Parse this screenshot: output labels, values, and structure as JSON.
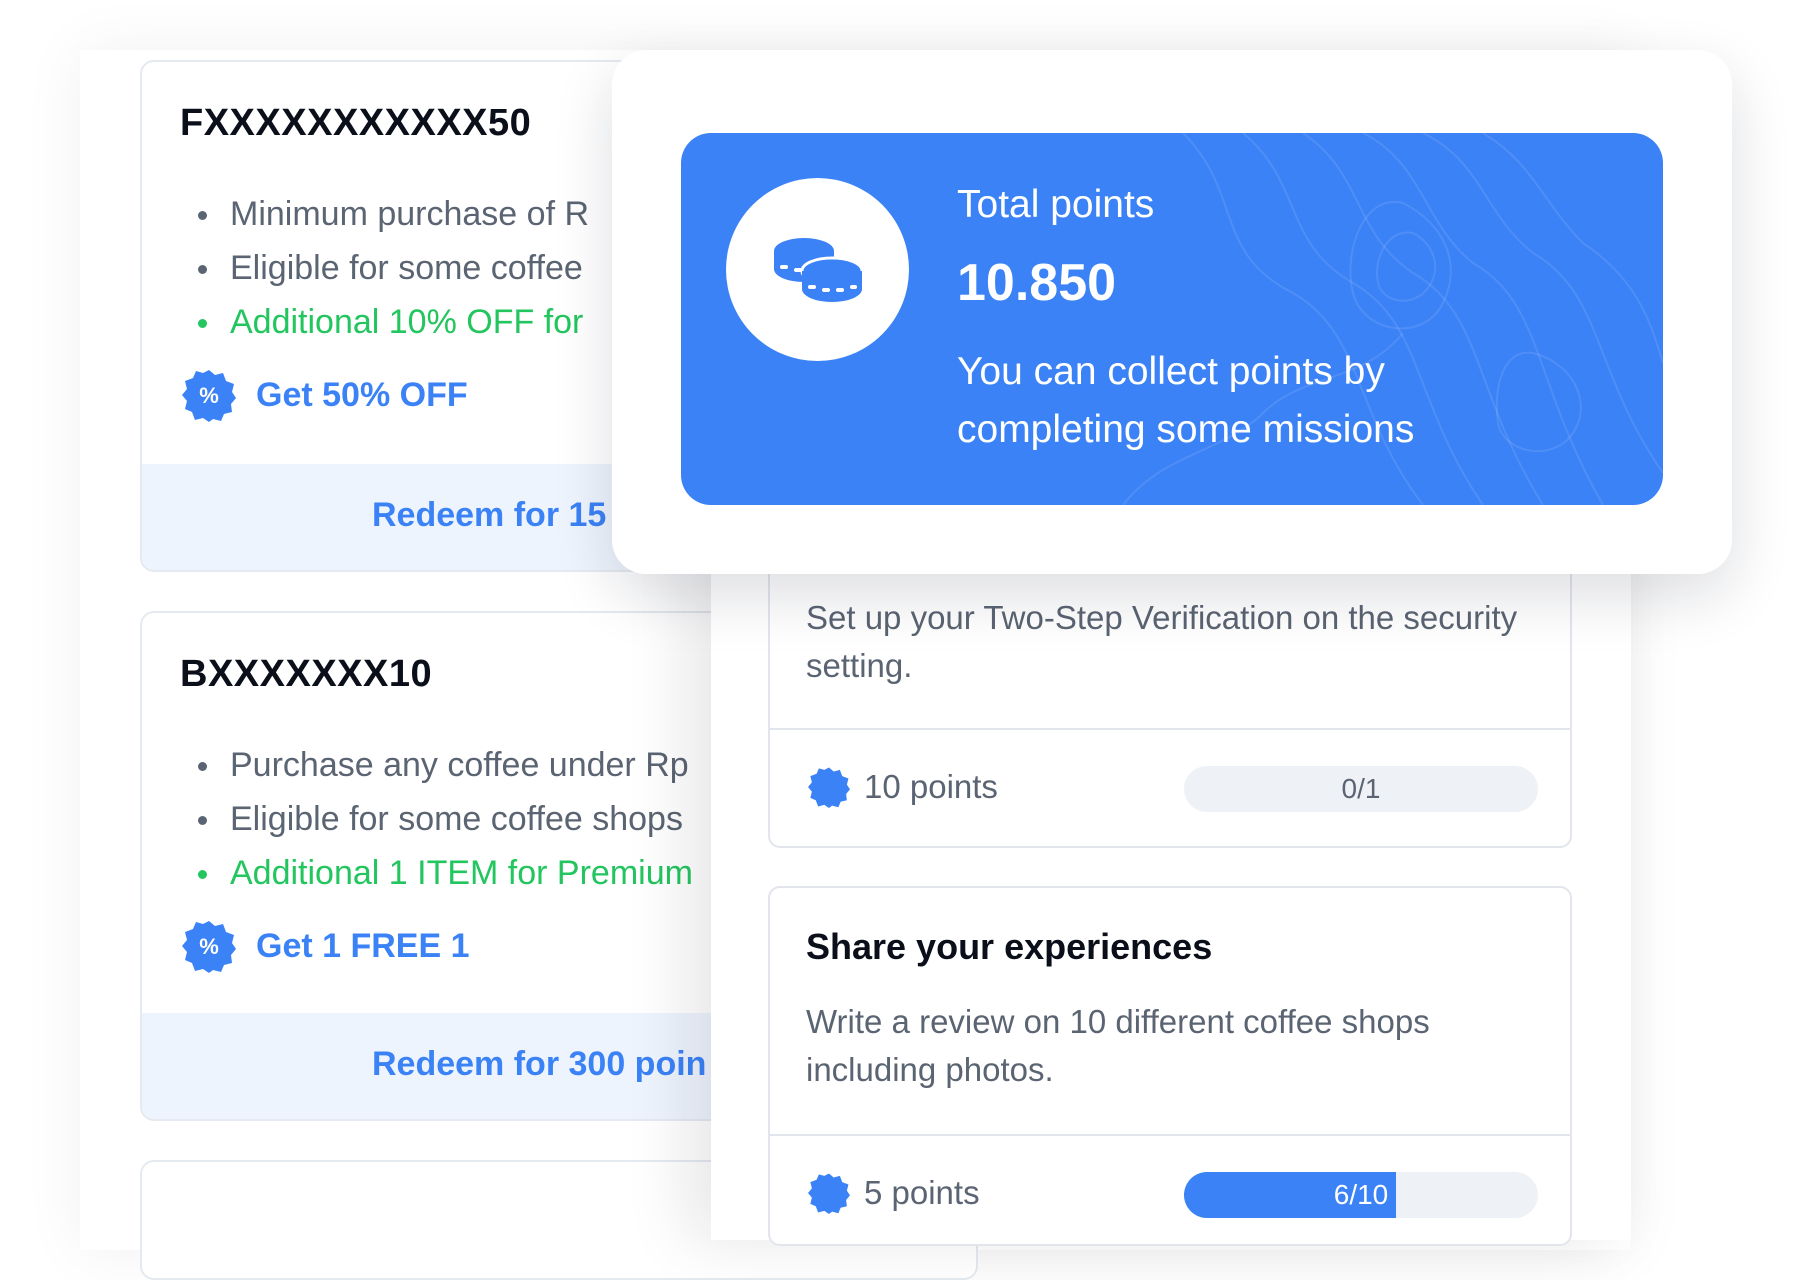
{
  "vouchers": [
    {
      "code": "FXXXXXXXXXXX50",
      "conditions": [
        "Minimum purchase of R",
        "Eligible for some coffee",
        "Additional 10% OFF for"
      ],
      "offer": "Get 50% OFF",
      "redeem": "Redeem for 15"
    },
    {
      "code": "BXXXXXXX10",
      "conditions": [
        "Purchase any coffee under Rp",
        "Eligible for some coffee shops",
        "Additional 1 ITEM for Premium"
      ],
      "offer": "Get 1 FREE 1",
      "redeem": "Redeem for 300 poin"
    }
  ],
  "total_points": {
    "label": "Total points",
    "value": "10.850",
    "description": "You can collect points by completing some missions"
  },
  "missions": [
    {
      "description": "Set up your Two-Step Verification on the security setting.",
      "points": "10 points",
      "progress_label": "0/1",
      "progress": 0
    },
    {
      "title": "Share your experiences",
      "description": "Write a review on 10 different coffee shops including photos.",
      "points": "5 points",
      "progress_label": "6/10",
      "progress": 0.6
    }
  ],
  "icons": {
    "offer_badge": "discount-badge-icon",
    "points_badge": "points-badge-icon",
    "coins": "coins-icon"
  },
  "colors": {
    "accent": "#3b82f6",
    "green": "#22c55e",
    "redeem_bg": "#eef4fd",
    "muted_text": "#5b6472"
  }
}
